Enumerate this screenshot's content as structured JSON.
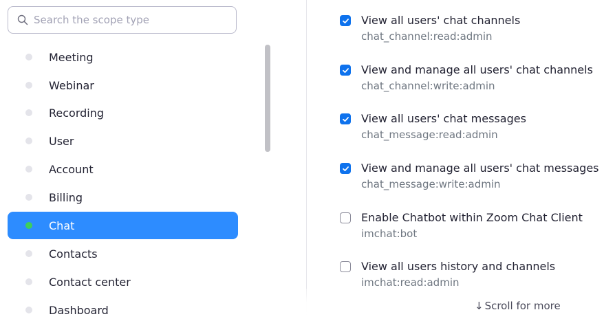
{
  "search": {
    "placeholder": "Search the scope type"
  },
  "categories": [
    {
      "label": "Meeting",
      "selected": false
    },
    {
      "label": "Webinar",
      "selected": false
    },
    {
      "label": "Recording",
      "selected": false
    },
    {
      "label": "User",
      "selected": false
    },
    {
      "label": "Account",
      "selected": false
    },
    {
      "label": "Billing",
      "selected": false
    },
    {
      "label": "Chat",
      "selected": true
    },
    {
      "label": "Contacts",
      "selected": false
    },
    {
      "label": "Contact center",
      "selected": false
    },
    {
      "label": "Dashboard",
      "selected": false
    }
  ],
  "scopes": [
    {
      "name": "View all users' chat channels",
      "code": "chat_channel:read:admin",
      "checked": true
    },
    {
      "name": "View and manage all users' chat channels",
      "code": "chat_channel:write:admin",
      "checked": true
    },
    {
      "name": "View all users' chat messages",
      "code": "chat_message:read:admin",
      "checked": true
    },
    {
      "name": "View and manage all users' chat messages",
      "code": "chat_message:write:admin",
      "checked": true
    },
    {
      "name": "Enable Chatbot within Zoom Chat Client",
      "code": "imchat:bot",
      "checked": false
    },
    {
      "name": "View all users history and channels",
      "code": "imchat:read:admin",
      "checked": false
    }
  ],
  "scroll_hint": {
    "arrow": "↓",
    "label": "Scroll for more"
  },
  "colors": {
    "accent": "#2d8cff",
    "checkbox": "#0e72ed",
    "active_dot": "#3ecf5a"
  }
}
